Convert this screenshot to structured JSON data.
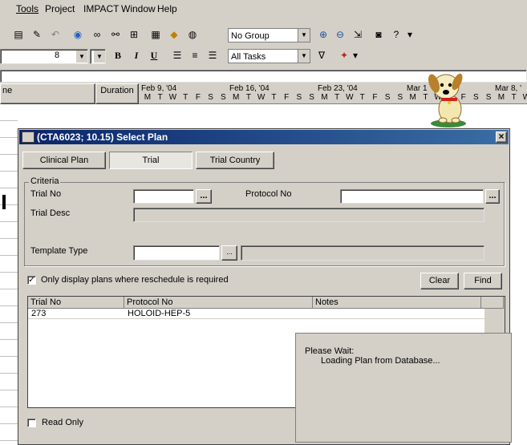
{
  "menu": {
    "tools": "Tools",
    "project": "Project",
    "impact": "IMPACT",
    "window": "Window",
    "help": "Help"
  },
  "toolbar": {
    "group_value": "No Group",
    "font_size": "8",
    "filter_value": "All Tasks",
    "bold": "B",
    "italic": "I",
    "underline": "U"
  },
  "gantt": {
    "col_name": "ne",
    "col_duration": "Duration",
    "weeks": [
      "Feb 9, '04",
      "Feb 16, '04",
      "Feb 23, '04",
      "Mar 1",
      "Mar 8, '"
    ],
    "days": [
      "M",
      "T",
      "W",
      "T",
      "F",
      "S",
      "S"
    ]
  },
  "dialog": {
    "title": "(CTA6023; 10.15) Select Plan",
    "close": "×",
    "tabs": [
      "Clinical Plan",
      "Trial",
      "Trial Country"
    ],
    "criteria_legend": "Criteria",
    "trial_no_label": "Trial No",
    "protocol_no_label": "Protocol No",
    "trial_desc_label": "Trial Desc",
    "template_type_label": "Template Type",
    "ellipsis": "...",
    "reschedule_label": "Only display plans where reschedule is required",
    "reschedule_checked": "✓",
    "clear_button": "Clear",
    "find_button": "Find",
    "columns": [
      "Trial No",
      "Protocol No",
      "Notes"
    ],
    "rows": [
      {
        "trial_no": "273",
        "protocol_no": "HOLOID-HEP-5",
        "notes": ""
      }
    ],
    "read_only_label": "Read Only"
  },
  "popup": {
    "line1": "Please Wait:",
    "line2": "Loading Plan from Database..."
  },
  "colors": {
    "title_start": "#0a246a",
    "title_end": "#3a6ea5",
    "face": "#d4d0c8"
  }
}
